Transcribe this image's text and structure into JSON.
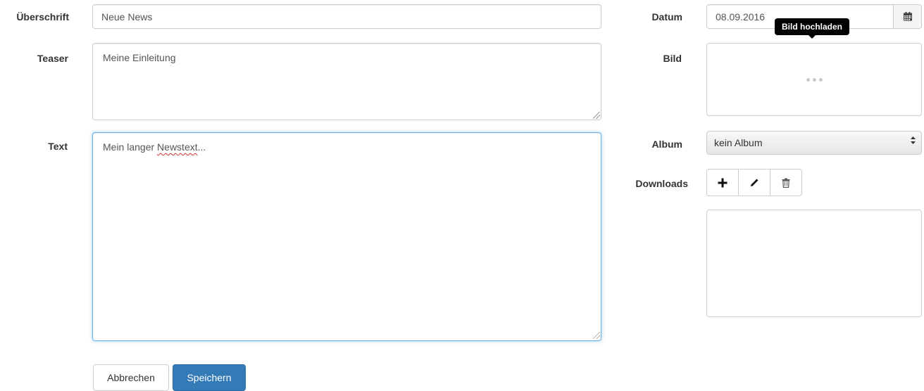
{
  "form": {
    "heading_label": "Überschrift",
    "heading_value": "Neue News",
    "teaser_label": "Teaser",
    "teaser_value": "Meine Einleitung",
    "text_label": "Text",
    "text_value_plain": "Mein langer ",
    "text_value_misspelled": "Newstext",
    "text_value_tail": "...",
    "date_label": "Datum",
    "date_value": "08.09.2016",
    "image_label": "Bild",
    "image_tooltip": "Bild hochladen",
    "album_label": "Album",
    "album_selected": "kein Album",
    "downloads_label": "Downloads"
  },
  "actions": {
    "cancel_label": "Abbrechen",
    "save_label": "Speichern"
  },
  "icons": {
    "calendar": "calendar-icon",
    "add": "plus-icon",
    "edit": "pencil-icon",
    "delete": "trash-icon",
    "select_caret": "updown-caret-icon"
  },
  "colors": {
    "primary": "#337ab7",
    "focus_border": "#66afe9",
    "tooltip_bg": "#000000"
  }
}
